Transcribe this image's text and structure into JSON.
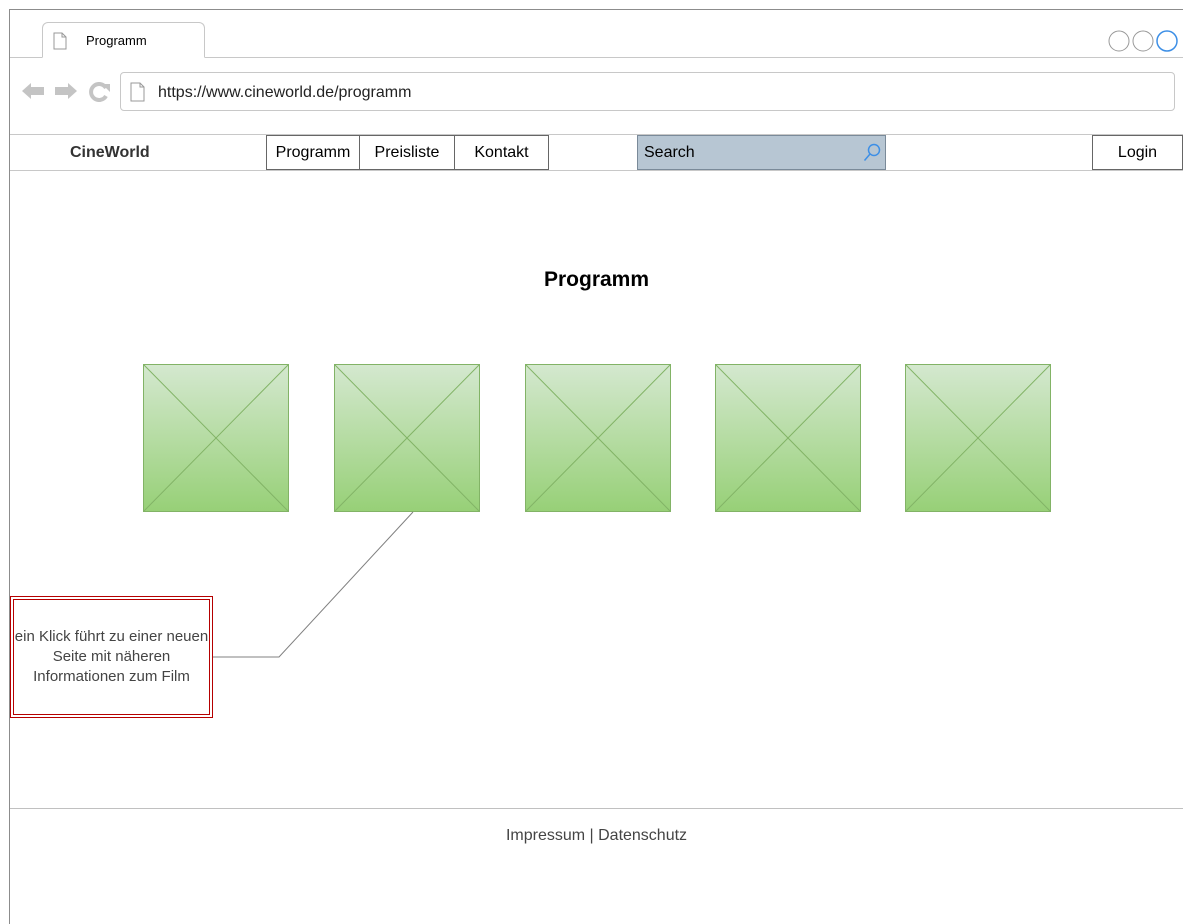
{
  "browser": {
    "tab_title": "Programm",
    "url": "https://www.cineworld.de/programm",
    "icons": [
      "document-icon",
      "back-arrow-icon",
      "forward-arrow-icon",
      "reload-icon",
      "window-control-icon"
    ]
  },
  "navbar": {
    "brand": "CineWorld",
    "items": [
      {
        "label": "Programm"
      },
      {
        "label": "Preisliste"
      },
      {
        "label": "Kontakt"
      }
    ],
    "search_label": "Search",
    "login_label": "Login"
  },
  "main": {
    "heading": "Programm",
    "movie_posters": [
      "image-placeholder",
      "image-placeholder",
      "image-placeholder",
      "image-placeholder",
      "image-placeholder"
    ]
  },
  "annotation": {
    "text": "ein Klick führt zu einer neuen Seite mit näheren Informationen zum Film"
  },
  "footer": {
    "text": "Impressum | Datenschutz"
  },
  "colors": {
    "search_bg": "#b7c6d3",
    "poster_top": "#d4e8cf",
    "poster_bottom": "#97d077",
    "annotation_border": "#b50000",
    "search_icon": "#3d8fe6"
  }
}
